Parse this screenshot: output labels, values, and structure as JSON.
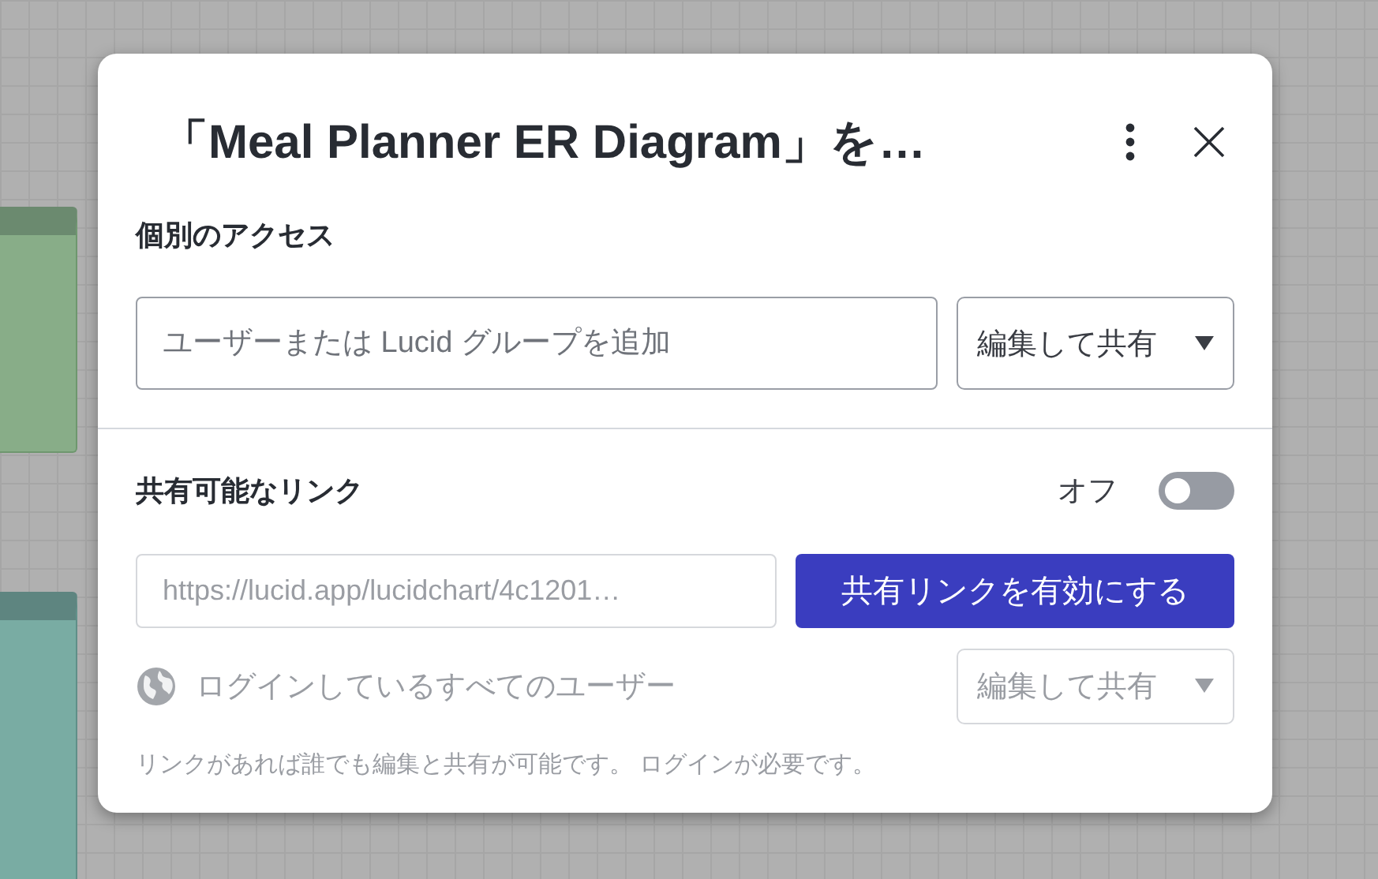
{
  "dialog": {
    "title": "「Meal Planner ER Diagram」を…",
    "individual_access": {
      "heading": "個別のアクセス",
      "invite_field": {
        "placeholder": "ユーザーまたは Lucid グループを追加"
      },
      "role_select": {
        "value": "編集して共有"
      }
    },
    "shareable_link": {
      "heading": "共有可能なリンク",
      "toggle": {
        "label": "オフ",
        "on": false
      },
      "link_field": {
        "value": "https://lucid.app/lucidchart/4c1201…"
      },
      "enable_button": {
        "label": "共有リンクを有効にする"
      },
      "audience": {
        "label": "ログインしているすべてのユーザー",
        "disabled": true,
        "role_select": {
          "value": "編集して共有"
        }
      },
      "note": "リンクがあれば誰でも編集と共有が可能です。 ログインが必要です。"
    }
  }
}
